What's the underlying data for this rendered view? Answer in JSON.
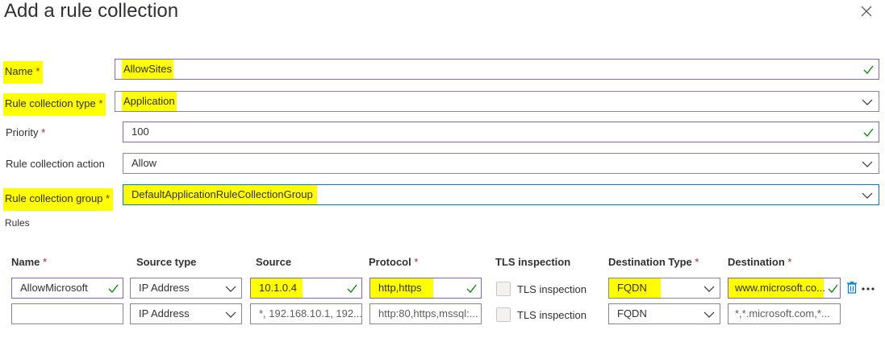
{
  "dialog": {
    "title": "Add a rule collection",
    "close_icon": "close-icon"
  },
  "form": {
    "name": {
      "label": "Name",
      "required": "*",
      "value": "AllowSites"
    },
    "type": {
      "label": "Rule collection type",
      "required": "*",
      "value": "Application"
    },
    "priority": {
      "label": "Priority",
      "required": "*",
      "value": "100"
    },
    "action": {
      "label": "Rule collection action",
      "value": "Allow"
    },
    "group": {
      "label": "Rule collection group",
      "required": "*",
      "value": "DefaultApplicationRuleCollectionGroup"
    }
  },
  "rules": {
    "label": "Rules",
    "headers": {
      "name": "Name",
      "source_type": "Source type",
      "source": "Source",
      "protocol": "Protocol",
      "tls": "TLS inspection",
      "dest_type": "Destination Type",
      "destination": "Destination",
      "required": "*"
    },
    "rows": [
      {
        "name": "AllowMicrosoft",
        "source_type": "IP Address",
        "source": "10.1.0.4",
        "protocol": "http,https",
        "tls": "TLS inspection",
        "dest_type": "FQDN",
        "destination": "www.microsoft.co..."
      },
      {
        "name": "",
        "source_type": "IP Address",
        "source_placeholder": "*, 192.168.10.1, 192...",
        "protocol_placeholder": "http:80,https,mssql:...",
        "tls": "TLS inspection",
        "dest_type": "FQDN",
        "destination_placeholder": "*,*.microsoft.com,*..."
      }
    ]
  },
  "colors": {
    "highlight": "#ffff00",
    "required": "#a4262c",
    "valid_border": "#8764b8",
    "focus_border": "#0078d4",
    "check": "#107c10"
  }
}
